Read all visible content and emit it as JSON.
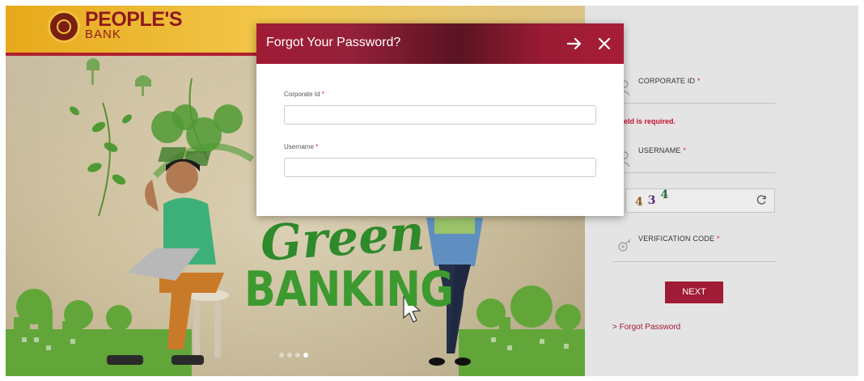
{
  "header": {
    "logo_line1": "PEOPLE'S",
    "logo_line2": "BANK"
  },
  "banner": {
    "headline_line1": "Green",
    "headline_line2": "BANKING",
    "carousel_dots": 4,
    "active_dot": 4
  },
  "login_form": {
    "corporate_id_label": "CORPORATE ID",
    "corporate_id_error": "s field is required.",
    "username_label": "USERNAME",
    "captcha_chars": [
      "4",
      "3",
      "4"
    ],
    "verification_label": "VERIFICATION CODE",
    "next_label": "NEXT",
    "forgot_link": "> Forgot Password",
    "required_marker": "*"
  },
  "modal": {
    "title": "Forgot Your Password?",
    "corporate_id_label": "Corporate Id",
    "corporate_id_value": "",
    "username_label": "Username",
    "username_value": "",
    "required_marker": "*"
  },
  "colors": {
    "brand_red": "#a01b35",
    "error_red": "#c8102e",
    "brand_gold": "#f2c64a",
    "eco_green": "#3c9a2f"
  },
  "icons": [
    "arrow-right-icon",
    "close-icon",
    "user-icon",
    "refresh-icon",
    "key-icon",
    "mouse-cursor-icon"
  ]
}
